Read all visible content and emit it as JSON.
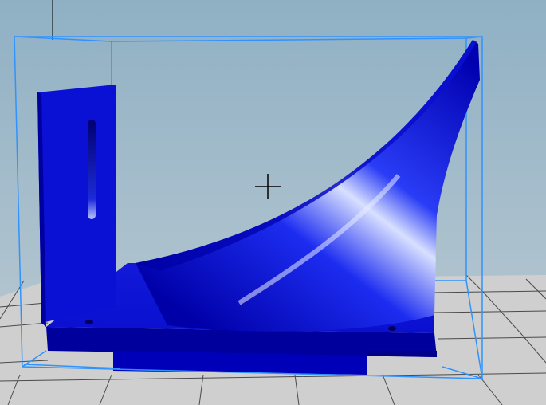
{
  "viewport": {
    "background_top_color": "#8fb0c4",
    "background_bottom_color": "#bdcbd3",
    "floor_color": "#cfcfcf",
    "grid_line_color": "#4a4a4a",
    "bounding_box_color": "#2f93ff",
    "model_color": "#0a0fd8",
    "model_highlight_color": "#dfe6ff",
    "model_shadow_color": "#00009a",
    "crosshair_color": "#000000",
    "crosshair_icon": "crosshair-icon"
  }
}
